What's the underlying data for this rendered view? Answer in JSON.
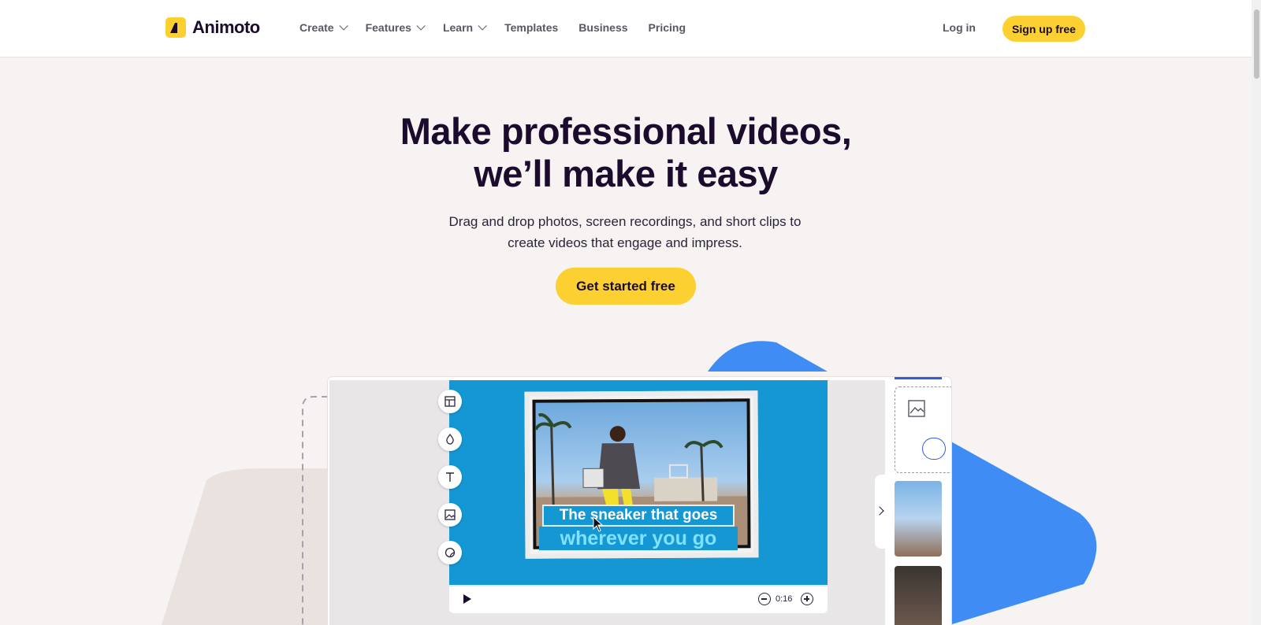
{
  "header": {
    "logo_text": "Animoto",
    "nav": [
      {
        "label": "Create",
        "dropdown": true
      },
      {
        "label": "Features",
        "dropdown": true
      },
      {
        "label": "Learn",
        "dropdown": true
      },
      {
        "label": "Templates",
        "dropdown": false
      },
      {
        "label": "Business",
        "dropdown": false
      },
      {
        "label": "Pricing",
        "dropdown": false
      }
    ],
    "login_label": "Log in",
    "signup_label": "Sign up free"
  },
  "hero": {
    "title_line1": "Make professional videos,",
    "title_line2": "we’ll make it easy",
    "subtitle_line1": "Drag and drop photos, screen recordings, and short clips to",
    "subtitle_line2": "create videos that engage and impress.",
    "cta_label": "Get started free"
  },
  "editor": {
    "caption_line1": "The sneaker that goes",
    "caption_line2": "wherever you go",
    "time": "0:16",
    "tools": [
      "layout-icon",
      "color-drop-icon",
      "text-icon",
      "image-icon",
      "sticker-icon"
    ]
  },
  "colors": {
    "accent": "#fdd032",
    "brand_text": "#1b0c2e",
    "stage_blue": "#1597d4",
    "shape_blue": "#3f8cf5"
  }
}
